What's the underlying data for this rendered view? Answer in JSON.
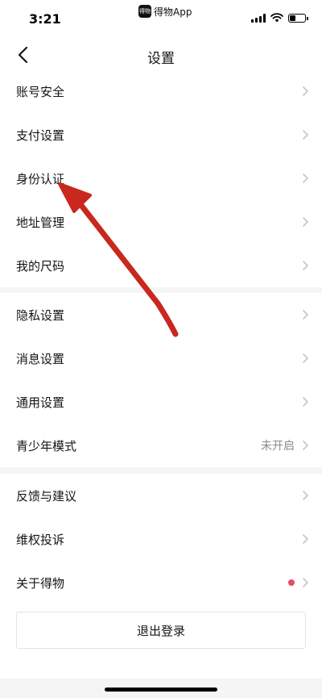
{
  "status_bar": {
    "time": "3:21",
    "app_badge_logo": "得物",
    "app_badge_name": "得物App"
  },
  "nav": {
    "title": "设置",
    "back_icon": "chevron-left-icon"
  },
  "groups": [
    {
      "items": [
        {
          "label": "账号安全"
        },
        {
          "label": "支付设置"
        },
        {
          "label": "身份认证"
        },
        {
          "label": "地址管理"
        },
        {
          "label": "我的尺码"
        }
      ]
    },
    {
      "items": [
        {
          "label": "隐私设置"
        },
        {
          "label": "消息设置"
        },
        {
          "label": "通用设置"
        },
        {
          "label": "青少年模式",
          "value": "未开启"
        }
      ]
    },
    {
      "items": [
        {
          "label": "反馈与建议"
        },
        {
          "label": "维权投诉"
        },
        {
          "label": "关于得物",
          "badge": "red-dot"
        }
      ]
    }
  ],
  "logout_label": "退出登录",
  "colors": {
    "background": "#f5f5f7",
    "card": "#ffffff",
    "text": "#14151a",
    "muted": "#8a8a93",
    "badge_red": "#e84a5f",
    "annotation_arrow": "#c8281e"
  }
}
